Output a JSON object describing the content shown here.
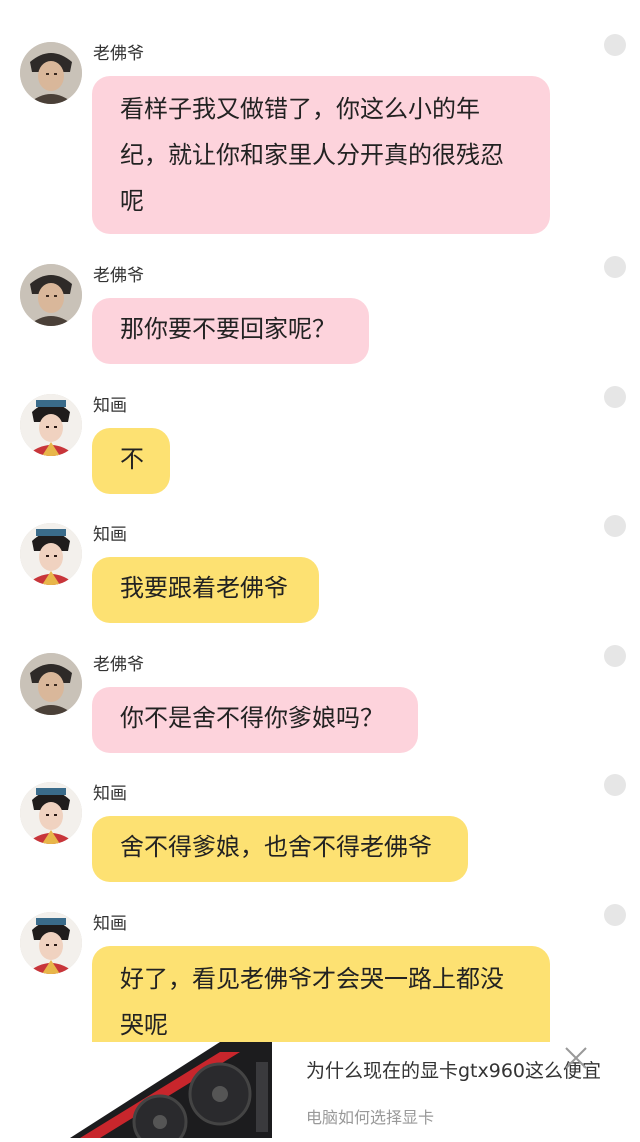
{
  "messages": [
    {
      "sender": "老佛爷",
      "avatar": "lao-foye",
      "bubble": "pink",
      "lines": [
        "看样子我又做错了，你这么小的年",
        "纪，就让你和家里人分开真的很残忍",
        "呢"
      ]
    },
    {
      "sender": "老佛爷",
      "avatar": "lao-foye",
      "bubble": "pink",
      "lines": [
        "那你要不要回家呢？"
      ]
    },
    {
      "sender": "知画",
      "avatar": "zhi-hua",
      "bubble": "yellow",
      "lines": [
        "不"
      ]
    },
    {
      "sender": "知画",
      "avatar": "zhi-hua",
      "bubble": "yellow",
      "lines": [
        "我要跟着老佛爷"
      ]
    },
    {
      "sender": "老佛爷",
      "avatar": "lao-foye",
      "bubble": "pink",
      "lines": [
        "你不是舍不得你爹娘吗？"
      ]
    },
    {
      "sender": "知画",
      "avatar": "zhi-hua",
      "bubble": "yellow",
      "lines": [
        "舍不得爹娘，也舍不得老佛爷"
      ]
    },
    {
      "sender": "知画",
      "avatar": "zhi-hua",
      "bubble": "yellow",
      "lines": [
        "好了，看见老佛爷才会哭一路上都没",
        "哭呢"
      ]
    }
  ],
  "ad": {
    "title": "为什么现在的显卡gtx960这么便宜",
    "subtitle": "电脑如何选择显卡",
    "image": "graphics-card"
  },
  "colors": {
    "pink_bubble": "#fdd3dc",
    "yellow_bubble": "#fde172"
  }
}
